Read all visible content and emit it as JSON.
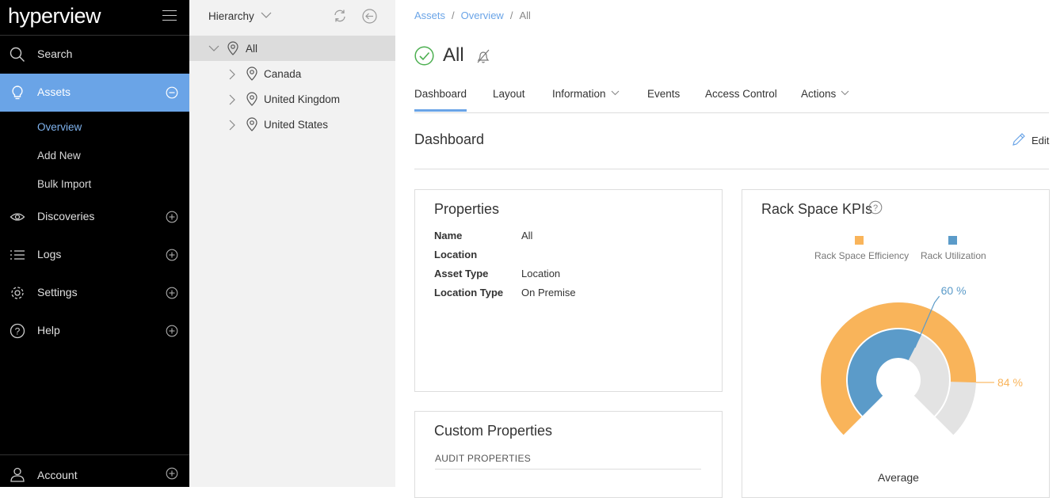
{
  "app": {
    "logo": "hyperview"
  },
  "sidebar": {
    "items": [
      {
        "label": "Search"
      },
      {
        "label": "Assets"
      },
      {
        "label": "Discoveries"
      },
      {
        "label": "Logs"
      },
      {
        "label": "Settings"
      },
      {
        "label": "Help"
      }
    ],
    "sub_items": [
      "Overview",
      "Add New",
      "Bulk Import"
    ],
    "account": "Account",
    "active_color": "#6aa4e7"
  },
  "hierarchy": {
    "header": "Hierarchy",
    "tree": {
      "root": "All",
      "children": [
        "Canada",
        "United Kingdom",
        "United States"
      ]
    }
  },
  "breadcrumb": [
    "Assets",
    "Overview",
    "All"
  ],
  "page": {
    "title": "All",
    "status": "check-circle",
    "status_color": "#4caf50"
  },
  "tabs": [
    "Dashboard",
    "Layout",
    "Information",
    "Events",
    "Access Control",
    "Actions"
  ],
  "dashboard": {
    "title": "Dashboard",
    "edit_label": "Edit"
  },
  "properties": {
    "title": "Properties",
    "rows": [
      {
        "key": "Name",
        "value": "All"
      },
      {
        "key": "Location",
        "value": ""
      },
      {
        "key": "Asset Type",
        "value": "Location"
      },
      {
        "key": "Location Type",
        "value": "On Premise"
      }
    ]
  },
  "custom_properties": {
    "title": "Custom Properties",
    "section": "AUDIT PROPERTIES"
  },
  "kpi": {
    "title": "Rack Space KPIs",
    "legend": [
      {
        "label": "Rack Space Efficiency",
        "color": "#f9b45a"
      },
      {
        "label": "Rack Utilization",
        "color": "#5b9bc9"
      }
    ],
    "efficiency_pct": 84,
    "utilization_pct": 60,
    "efficiency_label": "84 %",
    "utilization_label": "60 %",
    "footer": "Average"
  }
}
